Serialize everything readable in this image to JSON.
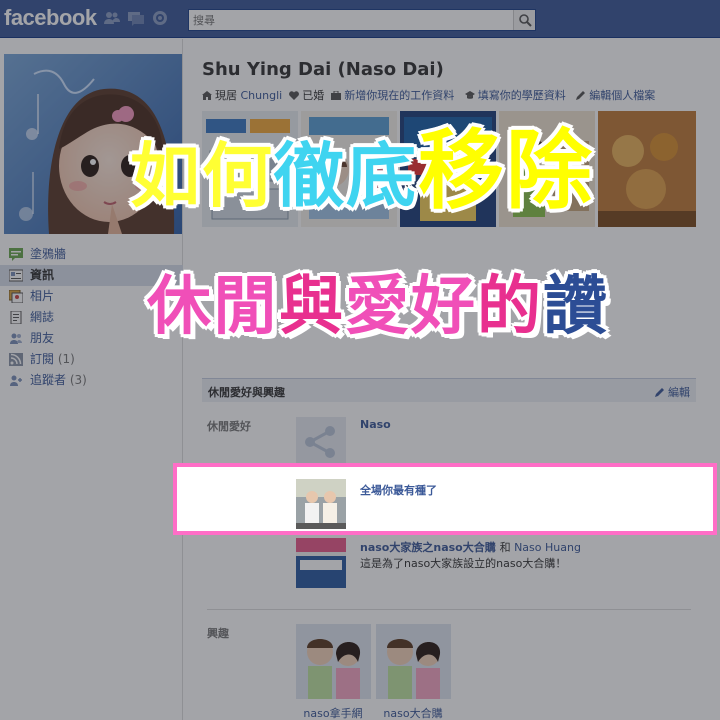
{
  "app": {
    "logo": "facebook"
  },
  "search": {
    "placeholder": "搜尋"
  },
  "sidebar": {
    "items": [
      {
        "label": "塗鴉牆",
        "count": ""
      },
      {
        "label": "資訊",
        "count": ""
      },
      {
        "label": "相片",
        "count": ""
      },
      {
        "label": "網誌",
        "count": ""
      },
      {
        "label": "朋友",
        "count": ""
      },
      {
        "label": "訂閱",
        "count": "(1)"
      },
      {
        "label": "追蹤者",
        "count": "(3)"
      }
    ]
  },
  "profile": {
    "name": "Shu Ying Dai (Naso Dai)",
    "lives_prefix": "現居",
    "lives_city": "Chungli",
    "relationship": "已婚",
    "add_work": "新增你現在的工作資料",
    "add_education": "填寫你的學歷資料",
    "edit_profile": "編輯個人檔案"
  },
  "section": {
    "title": "休閒愛好與興趣",
    "edit_label": "編輯",
    "activities_label": "休閒愛好",
    "interests_label": "興趣",
    "activities": [
      {
        "name": "Naso",
        "extra_and": "",
        "extra_with": "",
        "desc": ""
      },
      {
        "name": "全場你最有種了",
        "extra_and": "",
        "extra_with": "",
        "desc": ""
      },
      {
        "name": "naso大家族之naso大合購",
        "extra_and": "和",
        "extra_with": "Naso Huang",
        "desc": "這是為了naso大家族設立的naso大合購！"
      }
    ],
    "interests": [
      {
        "name": "naso拿手網"
      },
      {
        "name": "naso大合購"
      }
    ]
  },
  "overlay": {
    "line1": [
      {
        "text": "如何",
        "color": "#ffff33"
      },
      {
        "text": "徹底",
        "color": "#3fd4f0"
      },
      {
        "text": "移除",
        "color": "#ffff00"
      }
    ],
    "line2": [
      {
        "text": "休閒",
        "color": "#f04fb8"
      },
      {
        "text": "與",
        "color": "#e8308f"
      },
      {
        "text": "愛好",
        "color": "#f04fb8"
      },
      {
        "text": "的",
        "color": "#e8308f"
      },
      {
        "text": "讚",
        "color": "#2c4d95"
      }
    ]
  },
  "colors": {
    "brand": "#3b5998",
    "highlight": "#ff6ec7"
  }
}
